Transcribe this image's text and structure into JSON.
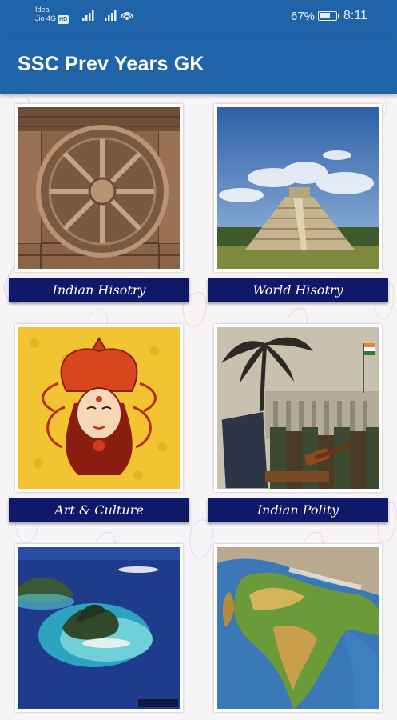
{
  "status_bar": {
    "carrier_line1": "Idea",
    "carrier_line2": "Jio 4G",
    "volte_badge": "HD",
    "battery_percent": "67%",
    "battery_level": 0.67,
    "time": "8:11",
    "icons": [
      "signal-icon",
      "signal-icon",
      "wifi-hotspot-icon",
      "battery-icon"
    ]
  },
  "app_bar": {
    "title": "SSC Prev Years GK",
    "color": "#1f63a8"
  },
  "categories": [
    {
      "label": "Indian Hisotry",
      "image": "konark-sun-temple-wheel"
    },
    {
      "label": "World Hisotry",
      "image": "chichen-itza-pyramid"
    },
    {
      "label": "Art & Culture",
      "image": "indian-goddess-art"
    },
    {
      "label": "Indian Polity",
      "image": "parliament-law-books-gavel"
    },
    {
      "label": "",
      "image": "island-aerial-view"
    },
    {
      "label": "",
      "image": "india-relief-map"
    }
  ],
  "label_color": "#10186a"
}
